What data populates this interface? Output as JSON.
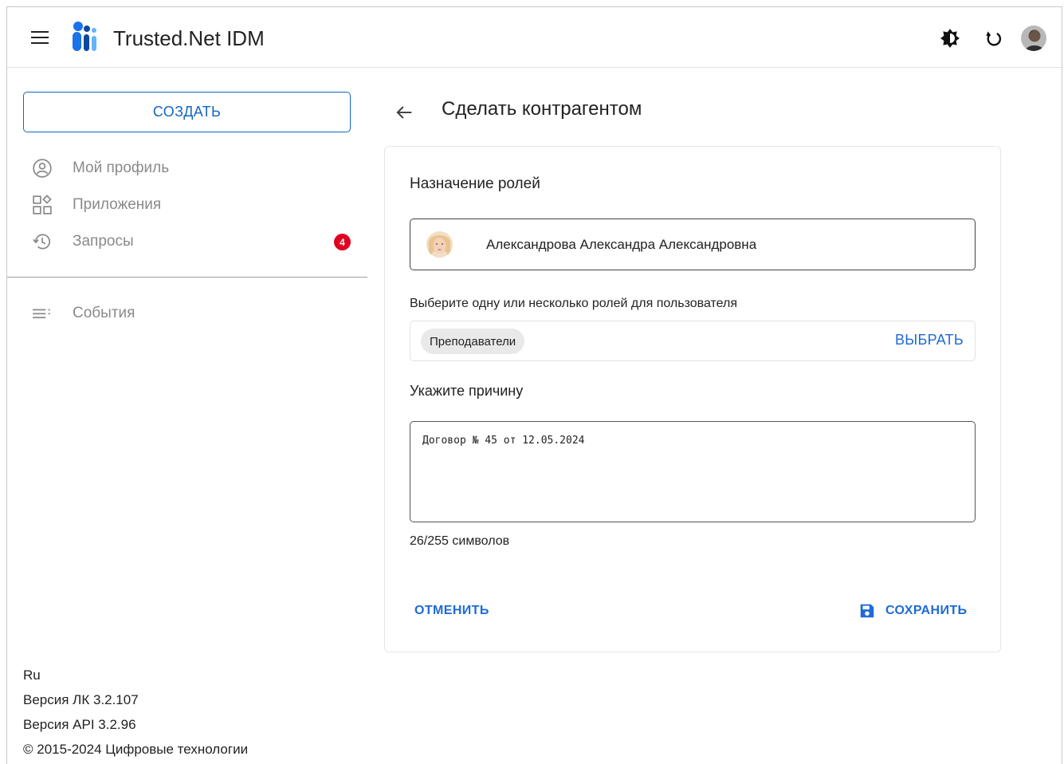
{
  "app": {
    "title": "Trusted.Net IDM"
  },
  "header": {
    "menu_icon": "hamburger-menu-icon",
    "theme_icon": "brightness-icon",
    "refresh_icon": "refresh-icon",
    "avatar_icon": "user-avatar-icon"
  },
  "sidebar": {
    "create_label": "СОЗДАТЬ",
    "items": [
      {
        "label": "Мой профиль",
        "icon": "account-circle-icon"
      },
      {
        "label": "Приложения",
        "icon": "apps-icon"
      },
      {
        "label": "Запросы",
        "icon": "history-icon",
        "badge": "4"
      },
      {
        "label": "События",
        "icon": "list-icon"
      }
    ],
    "footer": {
      "lang": "Ru",
      "version_lk": "Версия ЛК 3.2.107",
      "version_api": "Версия API 3.2.96",
      "copyright": "© 2015-2024 Цифровые технологии"
    }
  },
  "main": {
    "page_title": "Сделать контрагентом",
    "section_title": "Назначение ролей",
    "user_name": "Александрова Александра Александровна",
    "roles_label": "Выберите одну или несколько ролей для пользователя",
    "roles": [
      "Преподаватели"
    ],
    "choose_label": "ВЫБРАТЬ",
    "reason_label": "Укажите причину",
    "reason_value": "Договор № 45 от 12.05.2024",
    "counter": "26/255 символов",
    "cancel_label": "ОТМЕНИТЬ",
    "save_label": "СОХРАНИТЬ"
  },
  "colors": {
    "accent": "#1e6bd6",
    "badge": "#e00020",
    "muted_text": "#8a8a8a"
  }
}
